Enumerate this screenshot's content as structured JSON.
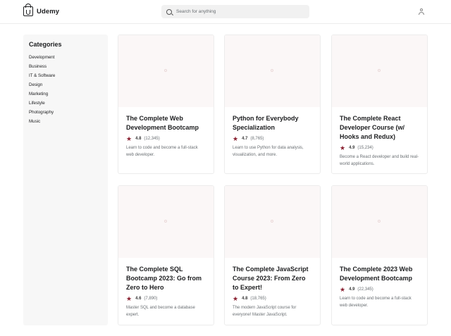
{
  "brand": {
    "name": "Udemy"
  },
  "search": {
    "placeholder": "Search for anything"
  },
  "sidebar": {
    "title": "Categories",
    "items": [
      {
        "label": "Development"
      },
      {
        "label": "Business"
      },
      {
        "label": "IT & Software"
      },
      {
        "label": "Design"
      },
      {
        "label": "Marketing"
      },
      {
        "label": "Lifestyle"
      },
      {
        "label": "Photography"
      },
      {
        "label": "Music"
      }
    ]
  },
  "courses": [
    {
      "title": "The Complete Web Development Bootcamp",
      "rating": "4.8",
      "reviews": "(12,345)",
      "description": "Learn to code and become a full-stack web developer."
    },
    {
      "title": "Python for Everybody Specialization",
      "rating": "4.7",
      "reviews": "(8,765)",
      "description": "Learn to use Python for data analysis, visualization, and more."
    },
    {
      "title": "The Complete React Developer Course (w/ Hooks and Redux)",
      "rating": "4.9",
      "reviews": "(15,234)",
      "description": "Become a React developer and build real-world applications."
    },
    {
      "title": "The Complete SQL Bootcamp 2023: Go from Zero to Hero",
      "rating": "4.6",
      "reviews": "(7,890)",
      "description": "Master SQL and become a database expert."
    },
    {
      "title": "The Complete JavaScript Course 2023: From Zero to Expert!",
      "rating": "4.8",
      "reviews": "(18,765)",
      "description": "The modern JavaScript course for everyone! Master JavaScript."
    },
    {
      "title": "The Complete 2023 Web Development Bootcamp",
      "rating": "4.9",
      "reviews": "(22,345)",
      "description": "Learn to code and become a full-stack web developer."
    }
  ],
  "colors": {
    "star": "#8a2131",
    "thumbnail": "#fbf7f7",
    "sidebar_bg": "#f7f7f7"
  },
  "icons": {
    "logo": "udemy-logo-icon",
    "search": "search-icon",
    "user": "user-icon",
    "star": "star-icon"
  }
}
